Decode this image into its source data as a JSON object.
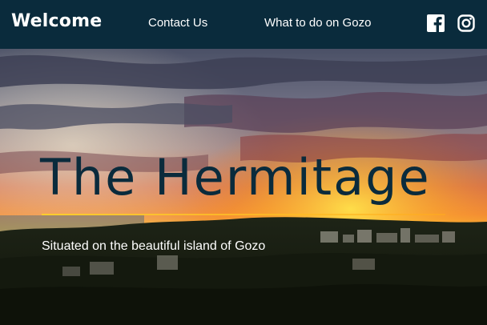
{
  "navbar": {
    "brand": "Welcome",
    "links": [
      {
        "label": "Contact Us"
      },
      {
        "label": "What to do on Gozo"
      }
    ],
    "social": [
      {
        "icon": "facebook-icon"
      },
      {
        "icon": "instagram-icon"
      }
    ],
    "background": "#0a2b3c"
  },
  "hero": {
    "title": "The Hermitage",
    "subtitle": "Situated on the beautiful island of Gozo",
    "title_color": "#0a2b3c",
    "accent_color": "#ffcc33"
  }
}
